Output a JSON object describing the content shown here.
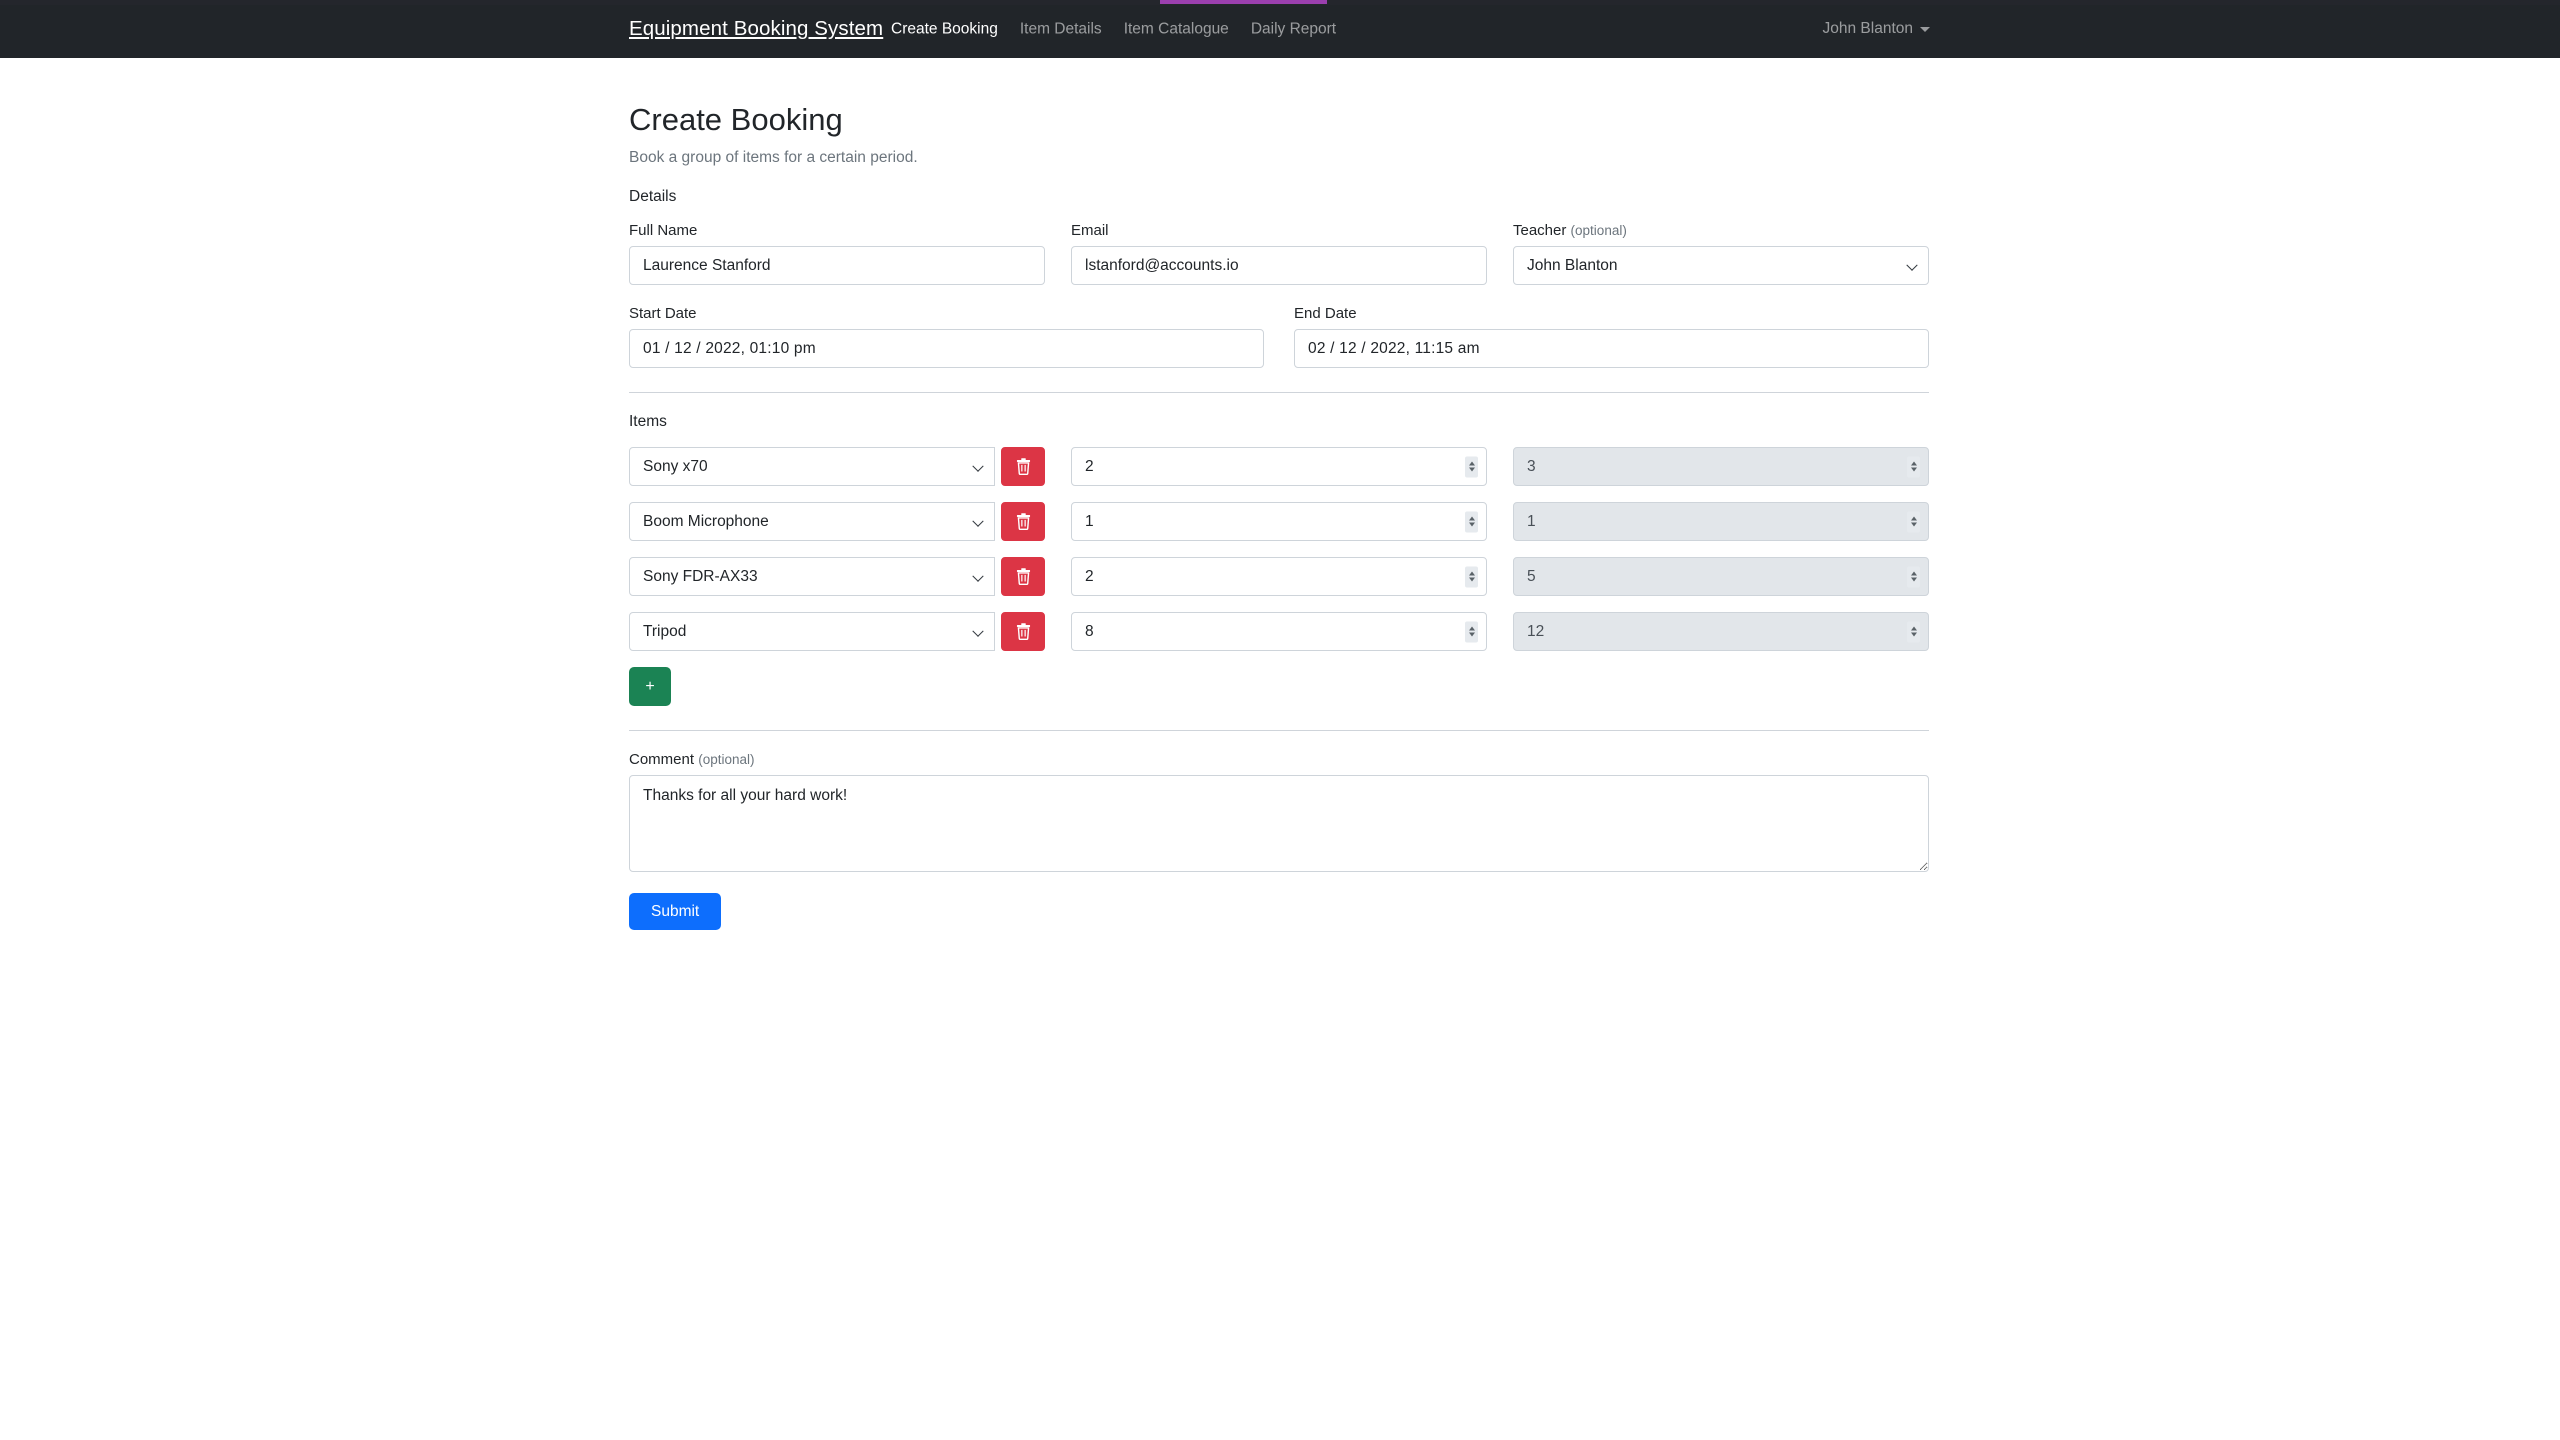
{
  "loading_bar": {
    "accent_color": "#9b3fae",
    "track_color": "#24262c"
  },
  "navbar": {
    "brand": "Equipment Booking System",
    "background": "#212529",
    "links": [
      {
        "label": "Create Booking",
        "active": true
      },
      {
        "label": "Item Details",
        "active": false
      },
      {
        "label": "Item Catalogue",
        "active": false
      },
      {
        "label": "Daily Report",
        "active": false
      }
    ],
    "user": {
      "name": "John Blanton",
      "caret_icon": "chevron-down-icon"
    }
  },
  "page": {
    "title": "Create Booking",
    "subtitle": "Book a group of items for a certain period."
  },
  "details": {
    "section_label": "Details",
    "full_name": {
      "label": "Full Name",
      "value": "Laurence Stanford",
      "placeholder": ""
    },
    "email": {
      "label": "Email",
      "value": "lstanford@accounts.io",
      "placeholder": ""
    },
    "teacher": {
      "label": "Teacher",
      "optional_text": "(optional)",
      "value": "John Blanton",
      "options": [
        "John Blanton"
      ]
    },
    "start_date": {
      "label": "Start Date",
      "value": "01 / 12 / 2022,  01:10  pm"
    },
    "end_date": {
      "label": "End Date",
      "value": "02 / 12 / 2022,  11:15  am"
    }
  },
  "items": {
    "section_label": "Items",
    "add_button_label": "+",
    "delete_icon": "trash-icon",
    "rows": [
      {
        "name": "Sony x70",
        "quantity": "2",
        "available": "3"
      },
      {
        "name": "Boom Microphone",
        "quantity": "1",
        "available": "1"
      },
      {
        "name": "Sony FDR-AX33",
        "quantity": "2",
        "available": "5"
      },
      {
        "name": "Tripod",
        "quantity": "8",
        "available": "12"
      }
    ]
  },
  "comment": {
    "label": "Comment",
    "optional_text": "(optional)",
    "value": "Thanks for all your hard work!",
    "placeholder": ""
  },
  "submit": {
    "label": "Submit",
    "color": "#0d6efd"
  },
  "colors": {
    "danger": "#dc3545",
    "success": "#1b8354",
    "primary": "#0d6efd",
    "muted": "#6c757d"
  }
}
